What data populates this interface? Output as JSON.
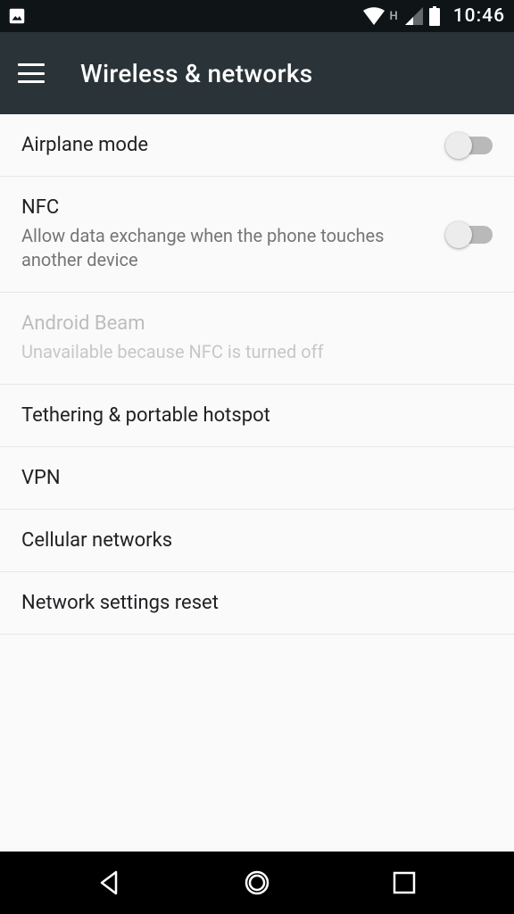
{
  "statusbar": {
    "network_type": "H",
    "time": "10:46"
  },
  "header": {
    "title": "Wireless & networks"
  },
  "settings": {
    "airplane": {
      "title": "Airplane mode"
    },
    "nfc": {
      "title": "NFC",
      "subtitle": "Allow data exchange when the phone touches another device"
    },
    "beam": {
      "title": "Android Beam",
      "subtitle": "Unavailable because NFC is turned off"
    },
    "tethering": {
      "title": "Tethering & portable hotspot"
    },
    "vpn": {
      "title": "VPN"
    },
    "cellular": {
      "title": "Cellular networks"
    },
    "reset": {
      "title": "Network settings reset"
    }
  }
}
